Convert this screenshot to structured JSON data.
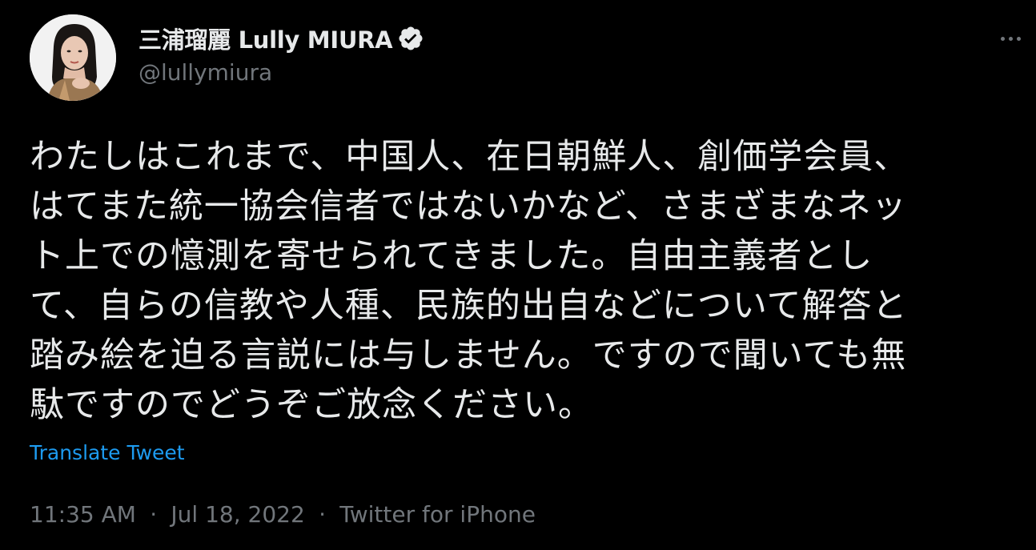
{
  "author": {
    "display_name": "三浦瑠麗 Lully MIURA",
    "handle": "@lullymiura",
    "verified_icon": "verified-badge-icon"
  },
  "tweet": {
    "lines": [
      "わたしはこれまで、中国人、在日朝鮮人、創価学会員、",
      "はてまた統一協会信者ではないかなど、さまざまなネッ",
      "ト上での憶測を寄せられてきました。自由主義者とし",
      "て、自らの信教や人種、民族的出自などについて解答と",
      "踏み絵を迫る言説には与しません。ですので聞いても無",
      "駄ですのでどうぞご放念ください。"
    ],
    "translate_label": "Translate Tweet"
  },
  "meta": {
    "time": "11:35 AM",
    "separator1": "·",
    "date": "Jul 18, 2022",
    "separator2": "·",
    "source": "Twitter for iPhone"
  },
  "colors": {
    "background": "#000000",
    "text": "#e7e9ea",
    "secondary": "#71767b",
    "link": "#1d9bf0"
  },
  "icons": {
    "more": "more-options-icon"
  }
}
